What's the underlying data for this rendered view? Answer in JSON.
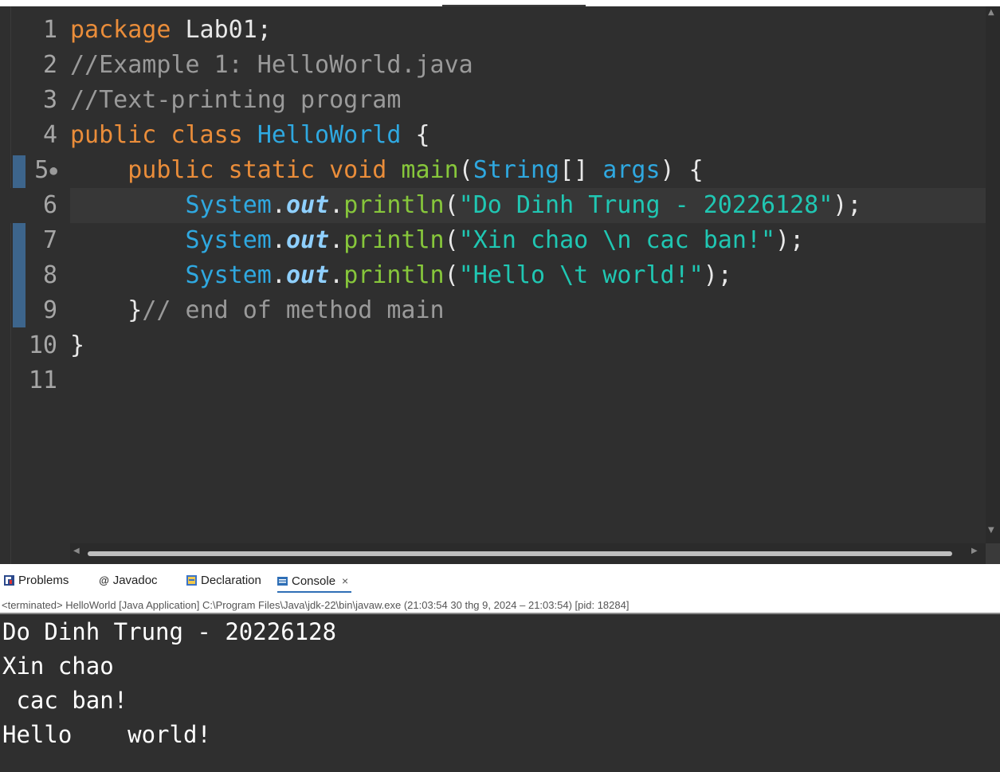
{
  "editor": {
    "lines": [
      {
        "num": "1",
        "fold": "",
        "tokens": [
          {
            "t": "kw",
            "v": "package"
          },
          {
            "t": "pl",
            "v": " Lab01;"
          }
        ]
      },
      {
        "num": "2",
        "fold": "",
        "tokens": [
          {
            "t": "cmt",
            "v": "//Example 1: HelloWorld.java"
          }
        ]
      },
      {
        "num": "3",
        "fold": "",
        "tokens": [
          {
            "t": "cmt",
            "v": "//Text-printing program"
          }
        ]
      },
      {
        "num": "4",
        "fold": "",
        "tokens": [
          {
            "t": "kw",
            "v": "public class"
          },
          {
            "t": "pl",
            "v": " "
          },
          {
            "t": "cls",
            "v": "HelloWorld"
          },
          {
            "t": "pl",
            "v": " {"
          }
        ]
      },
      {
        "num": "5",
        "fold": "●",
        "tokens": [
          {
            "t": "pl",
            "v": "    "
          },
          {
            "t": "kw",
            "v": "public static void"
          },
          {
            "t": "pl",
            "v": " "
          },
          {
            "t": "mth",
            "v": "main"
          },
          {
            "t": "pl",
            "v": "("
          },
          {
            "t": "cls",
            "v": "String"
          },
          {
            "t": "pl",
            "v": "[] "
          },
          {
            "t": "cls",
            "v": "args"
          },
          {
            "t": "pl",
            "v": ") {"
          }
        ]
      },
      {
        "num": "6",
        "fold": "",
        "current": true,
        "tokens": [
          {
            "t": "pl",
            "v": "        "
          },
          {
            "t": "cls",
            "v": "System"
          },
          {
            "t": "pl",
            "v": "."
          },
          {
            "t": "fld",
            "v": "out"
          },
          {
            "t": "pl",
            "v": "."
          },
          {
            "t": "mth",
            "v": "println"
          },
          {
            "t": "pl",
            "v": "("
          },
          {
            "t": "str",
            "v": "\"Do Dinh Trung - 20226128\""
          },
          {
            "t": "pl",
            "v": ");"
          }
        ]
      },
      {
        "num": "7",
        "fold": "",
        "tokens": [
          {
            "t": "pl",
            "v": "        "
          },
          {
            "t": "cls",
            "v": "System"
          },
          {
            "t": "pl",
            "v": "."
          },
          {
            "t": "fld",
            "v": "out"
          },
          {
            "t": "pl",
            "v": "."
          },
          {
            "t": "mth",
            "v": "println"
          },
          {
            "t": "pl",
            "v": "("
          },
          {
            "t": "str",
            "v": "\"Xin chao \\n cac ban!\""
          },
          {
            "t": "pl",
            "v": ");"
          }
        ]
      },
      {
        "num": "8",
        "fold": "",
        "tokens": [
          {
            "t": "pl",
            "v": "        "
          },
          {
            "t": "cls",
            "v": "System"
          },
          {
            "t": "pl",
            "v": "."
          },
          {
            "t": "fld",
            "v": "out"
          },
          {
            "t": "pl",
            "v": "."
          },
          {
            "t": "mth",
            "v": "println"
          },
          {
            "t": "pl",
            "v": "("
          },
          {
            "t": "str",
            "v": "\"Hello \\t world!\""
          },
          {
            "t": "pl",
            "v": ");"
          }
        ]
      },
      {
        "num": "9",
        "fold": "",
        "tokens": [
          {
            "t": "pl",
            "v": "    }"
          },
          {
            "t": "cmt",
            "v": "// end of method main"
          }
        ]
      },
      {
        "num": "10",
        "fold": "",
        "tokens": [
          {
            "t": "pl",
            "v": "}"
          }
        ]
      },
      {
        "num": "11",
        "fold": "",
        "tokens": []
      }
    ]
  },
  "panel": {
    "tabs": {
      "problems": "Problems",
      "javadoc": "Javadoc",
      "declaration": "Declaration",
      "console": "Console",
      "close_glyph": "×"
    },
    "status": "<terminated> HelloWorld [Java Application] C:\\Program Files\\Java\\jdk-22\\bin\\javaw.exe  (21:03:54 30 thg 9, 2024 – 21:03:54) [pid: 18284]",
    "output": [
      "Do Dinh Trung - 20226128",
      "Xin chao",
      " cac ban!",
      "Hello \t world!"
    ]
  },
  "colors": {
    "keyword": "#ea8d3a",
    "class": "#2fa8e0",
    "string": "#20c7b3",
    "method": "#87c73b",
    "comment": "#9a9a9a",
    "accent": "#2f6fb6"
  },
  "icons": {
    "problems": "problems-icon",
    "javadoc": "javadoc-icon",
    "declaration": "declaration-icon",
    "console": "console-icon"
  }
}
